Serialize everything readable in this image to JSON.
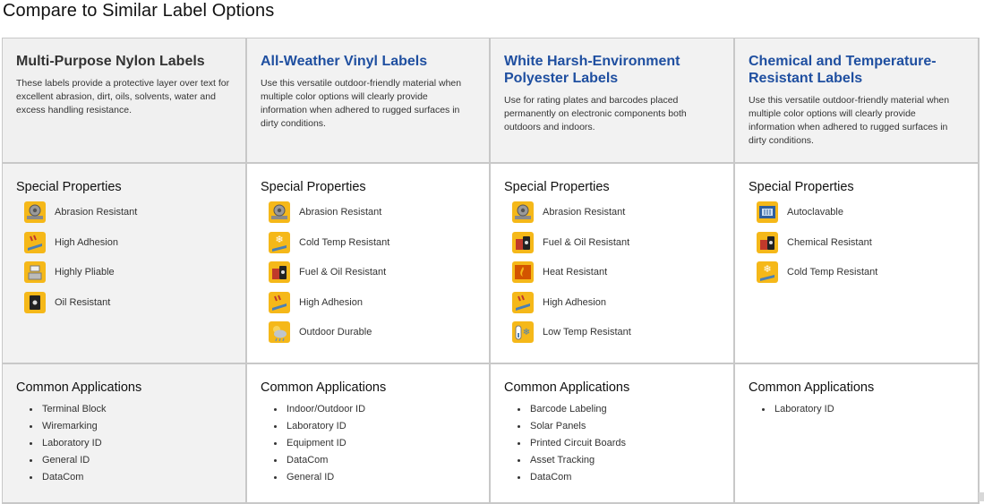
{
  "page": {
    "title": "Compare to Similar Label Options"
  },
  "sections": {
    "properties_title": "Special Properties",
    "applications_title": "Common Applications"
  },
  "columns": [
    {
      "title": "Multi-Purpose Nylon Labels",
      "description": "These labels provide a protective layer over text for excellent abrasion, dirt, oils, solvents, water and excess handling resistance.",
      "properties": [
        {
          "label": "Abrasion Resistant",
          "icon": "abrasion-icon"
        },
        {
          "label": "High Adhesion",
          "icon": "adhesion-icon"
        },
        {
          "label": "Highly Pliable",
          "icon": "pliable-icon"
        },
        {
          "label": "Oil Resistant",
          "icon": "oil-icon"
        }
      ],
      "applications": [
        "Terminal Block",
        "Wiremarking",
        "Laboratory ID",
        "General ID",
        "DataCom"
      ]
    },
    {
      "title": "All-Weather Vinyl Labels",
      "description": "Use this versatile outdoor-friendly material when multiple color options will clearly provide information when adhered to rugged surfaces in dirty conditions.",
      "properties": [
        {
          "label": "Abrasion Resistant",
          "icon": "abrasion-icon"
        },
        {
          "label": "Cold Temp Resistant",
          "icon": "cold-icon"
        },
        {
          "label": "Fuel & Oil Resistant",
          "icon": "fuel-icon"
        },
        {
          "label": "High Adhesion",
          "icon": "adhesion-icon"
        },
        {
          "label": "Outdoor Durable",
          "icon": "weather-icon"
        }
      ],
      "applications": [
        "Indoor/Outdoor ID",
        "Laboratory ID",
        "Equipment ID",
        "DataCom",
        "General ID"
      ]
    },
    {
      "title": "White Harsh-Environment Polyester Labels",
      "description": "Use for rating plates and barcodes placed permanently on electronic components both outdoors and indoors.",
      "properties": [
        {
          "label": "Abrasion Resistant",
          "icon": "abrasion-icon"
        },
        {
          "label": "Fuel & Oil Resistant",
          "icon": "fuel-icon"
        },
        {
          "label": "Heat Resistant",
          "icon": "heat-icon"
        },
        {
          "label": "High Adhesion",
          "icon": "adhesion-icon"
        },
        {
          "label": "Low Temp Resistant",
          "icon": "low-temp-icon"
        }
      ],
      "applications": [
        "Barcode Labeling",
        "Solar Panels",
        "Printed Circuit Boards",
        "Asset Tracking",
        "DataCom"
      ]
    },
    {
      "title": "Chemical and Temperature-Resistant Labels",
      "description": "Use this versatile outdoor-friendly material when multiple color options will clearly provide information when adhered to rugged surfaces in dirty conditions.",
      "properties": [
        {
          "label": "Autoclavable",
          "icon": "autoclave-icon"
        },
        {
          "label": "Chemical Resistant",
          "icon": "chemical-icon"
        },
        {
          "label": "Cold Temp Resistant",
          "icon": "cold-icon"
        }
      ],
      "applications": [
        "Laboratory ID"
      ]
    }
  ]
}
